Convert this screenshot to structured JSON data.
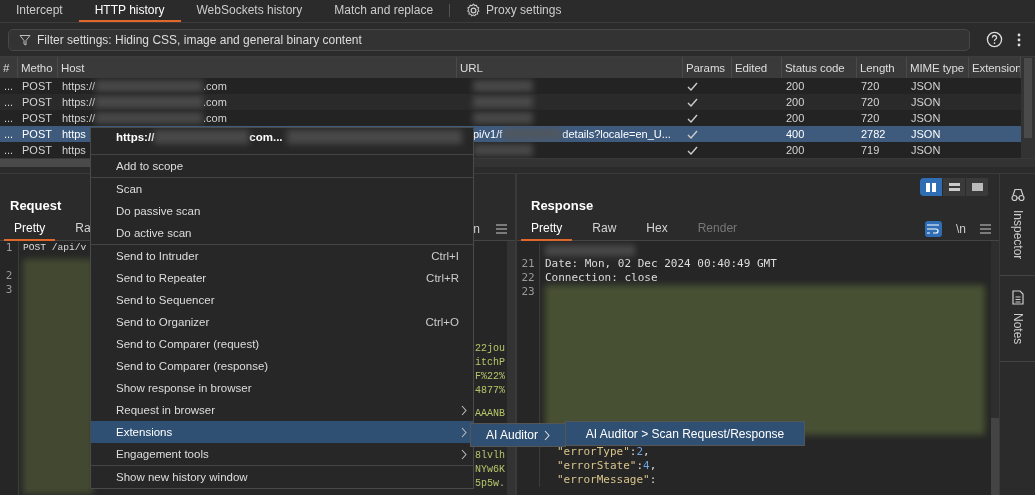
{
  "tabs": [
    {
      "label": "Intercept",
      "selected": false,
      "kind": "tab"
    },
    {
      "label": "HTTP history",
      "selected": true,
      "kind": "tab"
    },
    {
      "label": "WebSockets history",
      "selected": false,
      "kind": "tab"
    },
    {
      "label": "Match and replace",
      "selected": false,
      "kind": "tab"
    },
    {
      "label": "Proxy settings",
      "selected": false,
      "kind": "settings"
    }
  ],
  "filter": {
    "value": "Filter settings: Hiding CSS, image and general binary content"
  },
  "table": {
    "columns": [
      "#",
      "Metho",
      "Host",
      "URL",
      "Params",
      "Edited",
      "Status code",
      "Length",
      "MIME type",
      "Extension"
    ],
    "rows": [
      {
        "num": "...",
        "method": "POST",
        "host": [
          {
            "kind": "text",
            "text": "https://"
          },
          {
            "kind": "redacted"
          },
          {
            "kind": "text",
            "text": ".com"
          }
        ],
        "url": [
          {
            "kind": "redacted"
          }
        ],
        "params": true,
        "status": "200",
        "length": "720",
        "mime": "JSON",
        "selected": false
      },
      {
        "num": "...",
        "method": "POST",
        "host": [
          {
            "kind": "text",
            "text": "https://"
          },
          {
            "kind": "redacted"
          },
          {
            "kind": "text",
            "text": ".com"
          }
        ],
        "url": [
          {
            "kind": "redacted"
          }
        ],
        "params": true,
        "status": "200",
        "length": "720",
        "mime": "JSON",
        "selected": false
      },
      {
        "num": "...",
        "method": "POST",
        "host": [
          {
            "kind": "text",
            "text": "https://"
          },
          {
            "kind": "redacted"
          },
          {
            "kind": "text",
            "text": ".com"
          }
        ],
        "url": [
          {
            "kind": "redacted"
          }
        ],
        "params": true,
        "status": "200",
        "length": "720",
        "mime": "JSON",
        "selected": false
      },
      {
        "num": "...",
        "method": "POST",
        "host": [
          {
            "kind": "text",
            "text": "https"
          }
        ],
        "url": [
          {
            "kind": "text",
            "text": "pi/v1/f"
          },
          {
            "kind": "redacted"
          },
          {
            "kind": "text",
            "text": "details?locale=en_U..."
          }
        ],
        "params": true,
        "status": "400",
        "length": "2782",
        "mime": "JSON",
        "selected": true
      },
      {
        "num": "...",
        "method": "POST",
        "host": [
          {
            "kind": "text",
            "text": "https"
          }
        ],
        "url": [
          {
            "kind": "redacted"
          }
        ],
        "params": true,
        "status": "200",
        "length": "719",
        "mime": "JSON",
        "selected": false
      }
    ]
  },
  "request": {
    "title": "Request",
    "tabs": [
      {
        "label": "Pretty",
        "selected": true
      },
      {
        "label": "Ra",
        "selected": false
      }
    ],
    "toolbar_text": "n",
    "lines": [
      {
        "num": "1",
        "text": "POST /api/v"
      },
      {
        "num": "2"
      },
      {
        "num": "3"
      }
    ],
    "fragments_upper": [
      "22jou",
      "itchP",
      "F%22%",
      "4877%"
    ],
    "fragments_lower": [
      "AAANB",
      "8lvlh",
      "NYw6K",
      "5p5w."
    ]
  },
  "response": {
    "title": "Response",
    "tabs": [
      {
        "label": "Pretty",
        "selected": true,
        "disabled": false
      },
      {
        "label": "Raw",
        "selected": false,
        "disabled": false
      },
      {
        "label": "Hex",
        "selected": false,
        "disabled": false
      },
      {
        "label": "Render",
        "selected": false,
        "disabled": true
      }
    ],
    "wrap_on": true,
    "newline_label": "\\n",
    "layouts": [
      {
        "kind": "columns",
        "selected": true
      },
      {
        "kind": "rows",
        "selected": false
      },
      {
        "kind": "single",
        "selected": false
      }
    ],
    "lines": [
      {
        "kind": "redacted"
      },
      {
        "kind": "text",
        "num": "21",
        "text": "Date: Mon, 02 Dec 2024 00:40:49 GMT"
      },
      {
        "kind": "text",
        "num": "22",
        "text": "Connection: close"
      },
      {
        "kind": "block",
        "num": "23"
      },
      {
        "kind": "json",
        "key": "\"errorType\"",
        "sep": ":",
        "value": "2",
        "tail": ","
      },
      {
        "kind": "json",
        "key": "\"errorState\"",
        "sep": ":",
        "value": "4",
        "tail": ","
      },
      {
        "kind": "json",
        "key": "\"errorMessage\"",
        "sep": ":"
      }
    ]
  },
  "side_panel": [
    {
      "label": "Inspector",
      "kind": "inspector"
    },
    {
      "label": "Notes",
      "kind": "notes"
    }
  ],
  "context_menu": {
    "header": [
      {
        "kind": "text",
        "text": "https://"
      },
      {
        "kind": "redacted"
      },
      {
        "kind": "text",
        "text": "com..."
      },
      {
        "kind": "redacted"
      }
    ],
    "items": [
      {
        "kind": "item",
        "label": "Add to scope",
        "selected": false
      },
      {
        "kind": "separator"
      },
      {
        "kind": "item",
        "label": "Scan",
        "selected": false
      },
      {
        "kind": "item",
        "label": "Do passive scan",
        "selected": false
      },
      {
        "kind": "item",
        "label": "Do active scan",
        "selected": false
      },
      {
        "kind": "separator"
      },
      {
        "kind": "item",
        "label": "Send to Intruder",
        "shortcut": "Ctrl+I",
        "selected": false
      },
      {
        "kind": "item",
        "label": "Send to Repeater",
        "shortcut": "Ctrl+R",
        "selected": false
      },
      {
        "kind": "item",
        "label": "Send to Sequencer",
        "selected": false
      },
      {
        "kind": "item",
        "label": "Send to Organizer",
        "shortcut": "Ctrl+O",
        "selected": false
      },
      {
        "kind": "item",
        "label": "Send to Comparer (request)",
        "selected": false
      },
      {
        "kind": "item",
        "label": "Send to Comparer (response)",
        "selected": false
      },
      {
        "kind": "item",
        "label": "Show response in browser",
        "selected": false
      },
      {
        "kind": "item",
        "label": "Request in browser",
        "submenu": true,
        "selected": false
      },
      {
        "kind": "item",
        "label": "Extensions",
        "submenu": true,
        "selected": true
      },
      {
        "kind": "item",
        "label": "Engagement tools",
        "submenu": true,
        "selected": false
      },
      {
        "kind": "separator"
      },
      {
        "kind": "item",
        "label": "Show new history window",
        "selected": false
      }
    ]
  },
  "submenu": {
    "label": "AI Auditor",
    "submenu": true,
    "selected": true
  },
  "submenu_2": {
    "label": "AI Auditor > Scan Request/Response",
    "selected": true
  }
}
